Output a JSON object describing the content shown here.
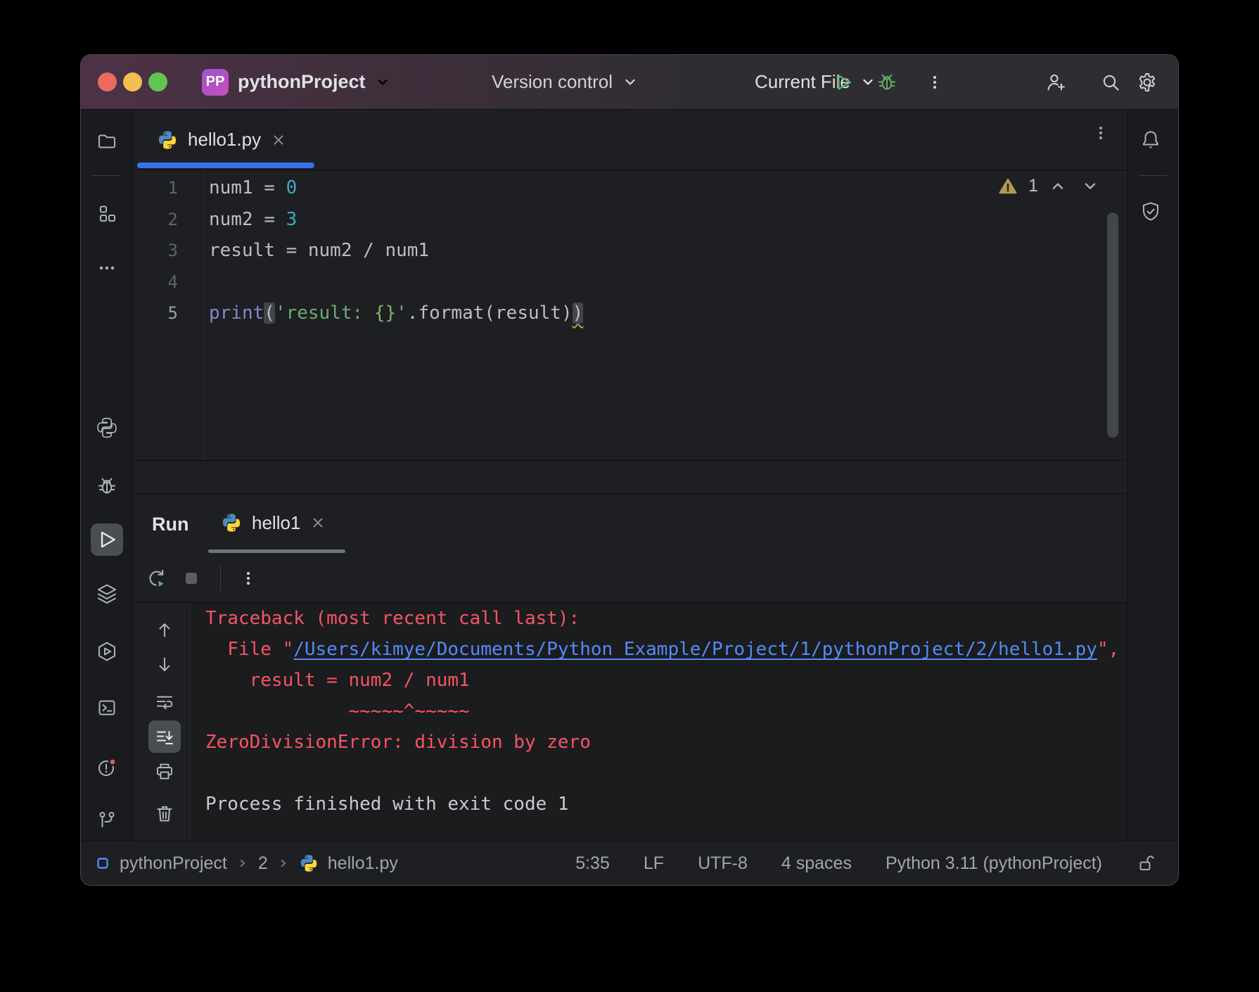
{
  "titlebar": {
    "project_badge": "PP",
    "project_name": "pythonProject",
    "version_control_label": "Version control",
    "run_config_label": "Current File"
  },
  "editor": {
    "tab_label": "hello1.py",
    "line_numbers": [
      "1",
      "2",
      "3",
      "4",
      "5"
    ],
    "code_lines": [
      [
        {
          "t": "num1 = ",
          "c": "plain"
        },
        {
          "t": "0",
          "c": "number"
        }
      ],
      [
        {
          "t": "num2 = ",
          "c": "plain"
        },
        {
          "t": "3",
          "c": "number"
        }
      ],
      [
        {
          "t": "result = num2 / num1",
          "c": "plain"
        }
      ],
      [],
      [
        {
          "t": "print",
          "c": "builtin"
        },
        {
          "t": "(",
          "c": "paren"
        },
        {
          "t": "'result: ",
          "c": "string"
        },
        {
          "t": "{}",
          "c": "format"
        },
        {
          "t": "'",
          "c": "string"
        },
        {
          "t": ".format(result)",
          "c": "plain"
        },
        {
          "t": ")",
          "c": "paren warn"
        }
      ]
    ],
    "warnings_count": "1"
  },
  "run_panel": {
    "title": "Run",
    "tab_label": "hello1",
    "console_lines": [
      [
        {
          "t": "Traceback (most recent call last):",
          "c": "err"
        }
      ],
      [
        {
          "t": "  File \"",
          "c": "err"
        },
        {
          "t": "/Users/kimye/Documents/Python_Example/Project/1/pythonProject/2/hello1.py",
          "c": "link"
        },
        {
          "t": "\",",
          "c": "err"
        }
      ],
      [
        {
          "t": "    result = num2 / num1",
          "c": "err"
        }
      ],
      [
        {
          "t": "             ~~~~~^~~~~~",
          "c": "err"
        }
      ],
      [
        {
          "t": "ZeroDivisionError: division by zero",
          "c": "err"
        }
      ],
      [],
      [
        {
          "t": "Process finished with exit code 1",
          "c": "plain"
        }
      ]
    ]
  },
  "statusbar": {
    "breadcrumb": [
      "pythonProject",
      "2",
      "hello1.py"
    ],
    "caret_position": "5:35",
    "line_separator": "LF",
    "encoding": "UTF-8",
    "indent": "4 spaces",
    "interpreter": "Python 3.11 (pythonProject)"
  },
  "colors": {
    "accent_blue": "#3574F0",
    "error_red": "#F75464",
    "link_blue": "#548AF7",
    "string_green": "#6AAB73",
    "number_teal": "#3FA8C4",
    "builtin_purple": "#8886C8",
    "warning_yellow": "#B3984E",
    "run_green": "#5FAD65"
  },
  "icons": {
    "titlebar": [
      "run-icon",
      "debug-icon",
      "more-icon",
      "add-user-icon",
      "search-icon",
      "settings-icon"
    ],
    "left_stripe": [
      "project-folder-icon",
      "structure-icon",
      "more-tools-icon",
      "python-packages-icon",
      "debug-tool-icon",
      "run-tool-icon",
      "services-icon",
      "python-console-icon",
      "terminal-icon",
      "problems-icon",
      "git-icon"
    ],
    "right_stripe": [
      "notifications-bell-icon",
      "shield-check-icon"
    ],
    "console_toolbar": [
      "up-arrow-icon",
      "down-arrow-icon",
      "soft-wrap-icon",
      "scroll-to-end-icon",
      "print-icon",
      "clear-trash-icon"
    ],
    "statusbar": [
      "breadcrumb-root-icon",
      "python-file-icon",
      "unlocked-icon"
    ]
  }
}
